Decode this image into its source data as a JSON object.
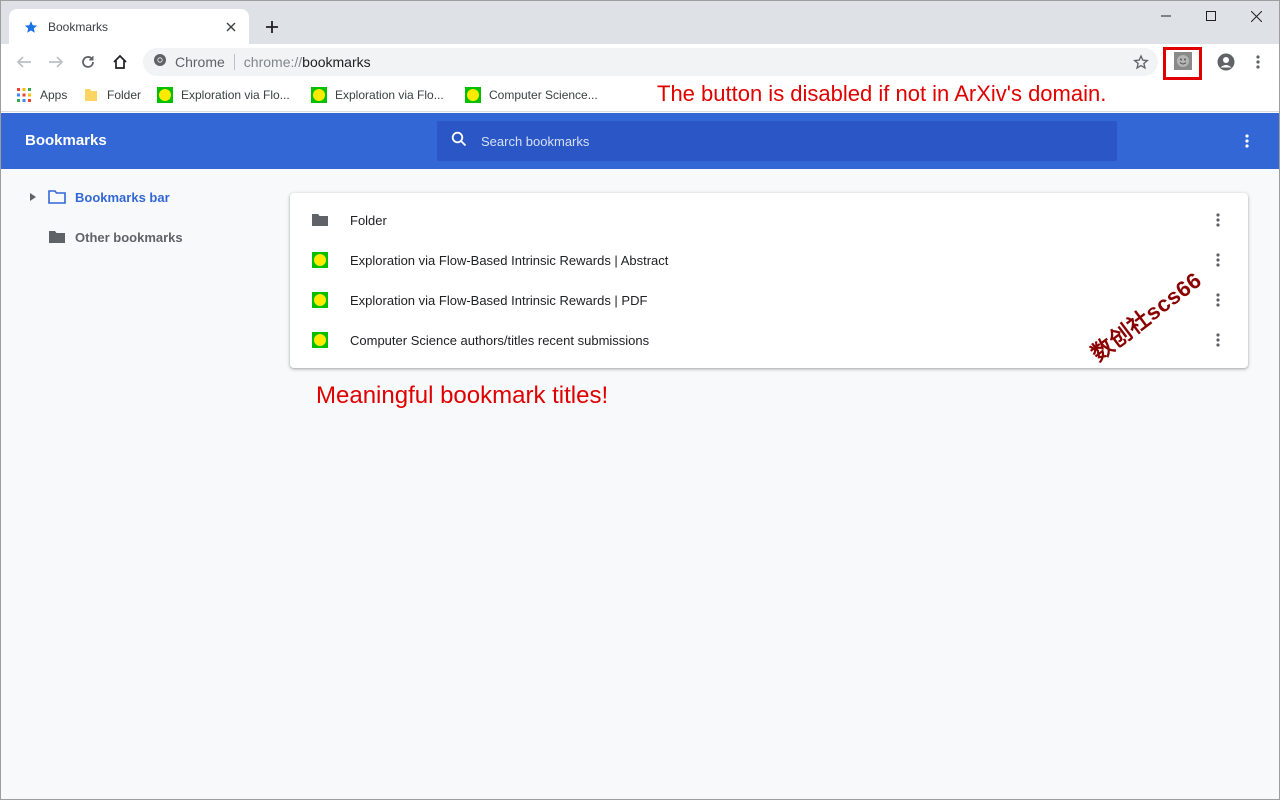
{
  "window": {
    "tab_title": "Bookmarks"
  },
  "toolbar": {
    "site_label": "Chrome",
    "url_scheme": "chrome://",
    "url_host": "bookmarks"
  },
  "bookmarks_bar": {
    "items": [
      {
        "label": "Apps",
        "icon": "apps-grid-icon"
      },
      {
        "label": "Folder",
        "icon": "folder-icon"
      },
      {
        "label": "Exploration via Flo...",
        "icon": "smiley-favicon-icon"
      },
      {
        "label": "Exploration via Flo...",
        "icon": "smiley-favicon-icon"
      },
      {
        "label": "Computer Science...",
        "icon": "smiley-favicon-icon"
      }
    ]
  },
  "annotations": {
    "top": "The button is disabled if not in ArXiv's domain.",
    "middle": "Meaningful bookmark titles!",
    "watermark": "数创社scs66"
  },
  "manager": {
    "title": "Bookmarks",
    "search_placeholder": "Search bookmarks"
  },
  "sidebar": {
    "items": [
      {
        "label": "Bookmarks bar",
        "selected": true
      },
      {
        "label": "Other bookmarks",
        "selected": false
      }
    ]
  },
  "list": {
    "items": [
      {
        "title": "Folder",
        "icon": "folder-icon"
      },
      {
        "title": "Exploration via Flow-Based Intrinsic Rewards | Abstract",
        "icon": "smiley-favicon-icon"
      },
      {
        "title": "Exploration via Flow-Based Intrinsic Rewards | PDF",
        "icon": "smiley-favicon-icon"
      },
      {
        "title": "Computer Science authors/titles recent submissions",
        "icon": "smiley-favicon-icon"
      }
    ]
  },
  "colors": {
    "header_blue": "#3367d6",
    "search_blue": "#2a56c6",
    "selected_text": "#3367d6",
    "annotation_red": "#e00000"
  }
}
